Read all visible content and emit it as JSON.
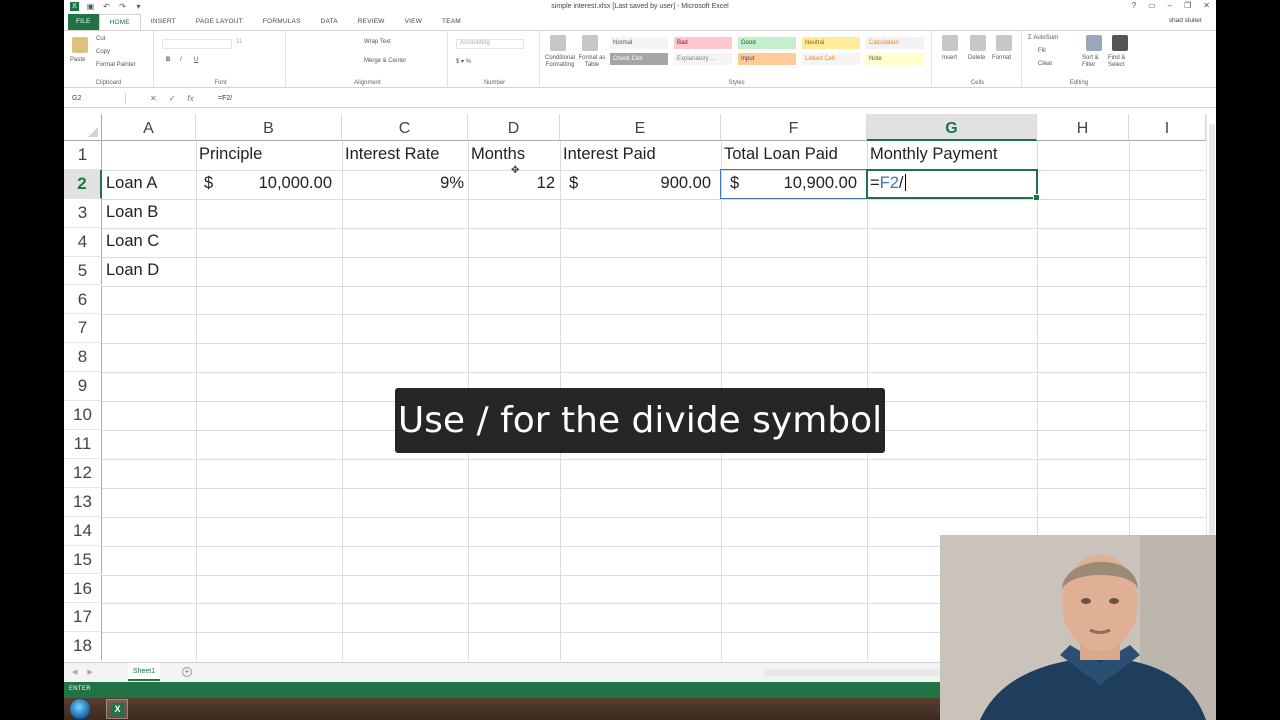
{
  "window": {
    "title": "simple interest.xlsx  [Last saved by user] - Microsoft Excel",
    "user": "shad sluiter"
  },
  "tabs": [
    "FILE",
    "HOME",
    "INSERT",
    "PAGE LAYOUT",
    "FORMULAS",
    "DATA",
    "REVIEW",
    "VIEW",
    "TEAM"
  ],
  "ribbon": {
    "clipboard": {
      "paste": "Paste",
      "cut": "Cut",
      "copy": "Copy",
      "format_painter": "Format Painter",
      "label": "Clipboard"
    },
    "font": {
      "size": "11",
      "label": "Font"
    },
    "alignment": {
      "wrap_text": "Wrap Text",
      "merge_center": "Merge & Center",
      "label": "Alignment"
    },
    "number": {
      "format": "Accounting",
      "label": "Number"
    },
    "styles": {
      "conditional": "Conditional Formatting",
      "format_table": "Format as Table",
      "normal": "Normal",
      "bad": "Bad",
      "good": "Good",
      "neutral": "Neutral",
      "calculation": "Calculation",
      "check_cell": "Check Cell",
      "explanatory": "Explanatory ...",
      "input": "Input",
      "linked_cell": "Linked Cell",
      "note": "Note",
      "label": "Styles"
    },
    "cells": {
      "insert": "Insert",
      "delete": "Delete",
      "format": "Format",
      "label": "Cells"
    },
    "editing": {
      "autosum": "AutoSum",
      "fill": "Fill",
      "clear": "Clear",
      "sort_filter": "Sort & Filter",
      "find_select": "Find & Select",
      "label": "Editing"
    }
  },
  "formula_bar": {
    "name_box": "G2",
    "formula": "=F2/"
  },
  "columns": [
    "A",
    "B",
    "C",
    "D",
    "E",
    "F",
    "G",
    "H",
    "I"
  ],
  "rows": [
    "1",
    "2",
    "3",
    "4",
    "5",
    "6",
    "7",
    "8",
    "9",
    "10",
    "11",
    "12",
    "13",
    "14",
    "15",
    "16",
    "17",
    "18"
  ],
  "headers": {
    "b": "Principle",
    "c": "Interest Rate",
    "d": "Months",
    "e": "Interest Paid",
    "f": "Total Loan Paid",
    "g": "Monthly Payment"
  },
  "data_rows": [
    {
      "a": "Loan A",
      "b_sym": "$",
      "b": "10,000.00",
      "c": "9%",
      "d": "12",
      "e_sym": "$",
      "e": "900.00",
      "f_sym": "$",
      "f": "10,900.00"
    },
    {
      "a": "Loan B"
    },
    {
      "a": "Loan C"
    },
    {
      "a": "Loan D"
    }
  ],
  "editing": {
    "eq": "=",
    "ref": "F2",
    "op": "/"
  },
  "sheets": [
    "Sheet1"
  ],
  "status": "ENTER",
  "caption": "Use / for the divide symbol",
  "colors": {
    "excel_green": "#217346",
    "ref_blue": "#4472c4"
  }
}
